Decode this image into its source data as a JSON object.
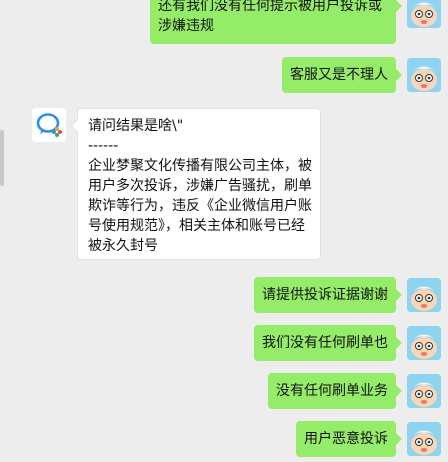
{
  "messages": [
    {
      "id": "m1",
      "side": "out",
      "lines": [
        "还有我们没有任何提示被用户投诉或",
        "涉嫌违规"
      ]
    },
    {
      "id": "m2",
      "side": "out",
      "lines": [
        "客服又是不理人"
      ]
    },
    {
      "id": "m3",
      "side": "in",
      "lines": [
        "请问结果是啥\\\"",
        "------",
        "企业梦聚文化传播有限公司主体，被",
        "用户多次投诉，涉嫌广告骚扰，刷单",
        "欺诈等行为，违反《企业微信用户账",
        "号使用规范》，相关主体和账号已经",
        "被永久封号"
      ]
    },
    {
      "id": "m4",
      "side": "out",
      "lines": [
        "请提供投诉证据谢谢"
      ]
    },
    {
      "id": "m5",
      "side": "out",
      "lines": [
        "我们没有任何刷单也"
      ]
    },
    {
      "id": "m6",
      "side": "out",
      "lines": [
        "没有任何刷单业务"
      ]
    },
    {
      "id": "m7",
      "side": "out",
      "lines": [
        "用户恶意投诉"
      ]
    }
  ],
  "colors": {
    "background": "#ededed",
    "outgoing_bubble": "#95ec69",
    "incoming_bubble": "#ffffff",
    "wecom_icon_blue": "#2d8cf0"
  },
  "icons": {
    "self_avatar": "cartoon-avatar-icon",
    "contact_avatar": "wecom-logo-icon"
  }
}
